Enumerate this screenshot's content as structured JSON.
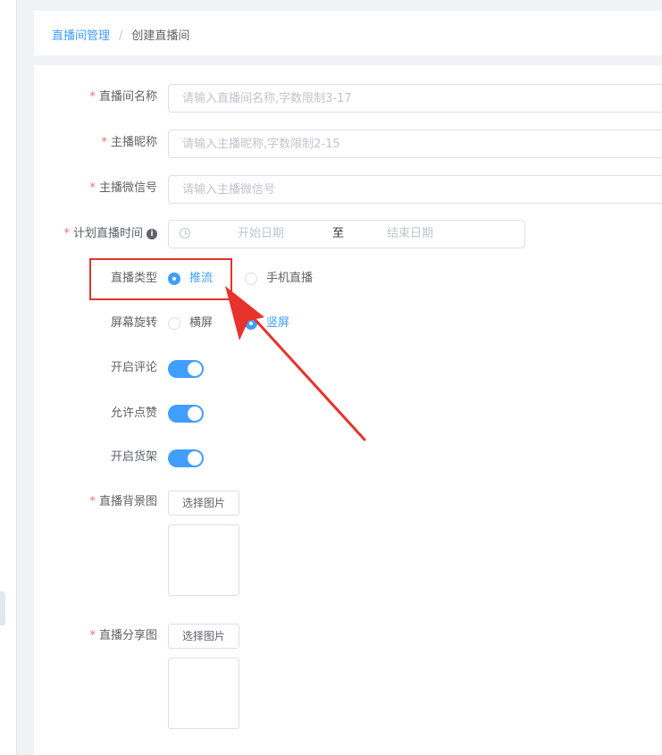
{
  "breadcrumb": {
    "parent": "直播间管理",
    "separator": "/",
    "current": "创建直播间"
  },
  "form": {
    "room_name": {
      "label": "直播间名称",
      "placeholder": "请输入直播间名称,字数限制3-17",
      "required": "*"
    },
    "anchor_nickname": {
      "label": "主播昵称",
      "placeholder": "请输入主播昵称,字数限制2-15",
      "required": "*"
    },
    "anchor_wechat": {
      "label": "主播微信号",
      "placeholder": "请输入主播微信号",
      "required": "*"
    },
    "plan_time": {
      "label": "计划直播时间",
      "start_placeholder": "开始日期",
      "to": "至",
      "end_placeholder": "结束日期",
      "required": "*",
      "info_icon": "i"
    },
    "live_type": {
      "label": "直播类型",
      "options": [
        "推流",
        "手机直播"
      ],
      "selected": "推流"
    },
    "orientation": {
      "label": "屏幕旋转",
      "options": [
        "横屏",
        "竖屏"
      ],
      "selected": "竖屏"
    },
    "comments": {
      "label": "开启评论",
      "on": true
    },
    "likes": {
      "label": "允许点赞",
      "on": true
    },
    "shelf": {
      "label": "开启货架",
      "on": true
    },
    "background_image": {
      "label": "直播背景图",
      "button": "选择图片",
      "required": "*"
    },
    "share_image": {
      "label": "直播分享图",
      "button": "选择图片",
      "required": "*"
    }
  },
  "colors": {
    "primary": "#409eff",
    "required": "#f56c6c",
    "annotation": "#e8322c"
  },
  "icons": {
    "clock": "clock-icon",
    "info": "info-icon"
  }
}
